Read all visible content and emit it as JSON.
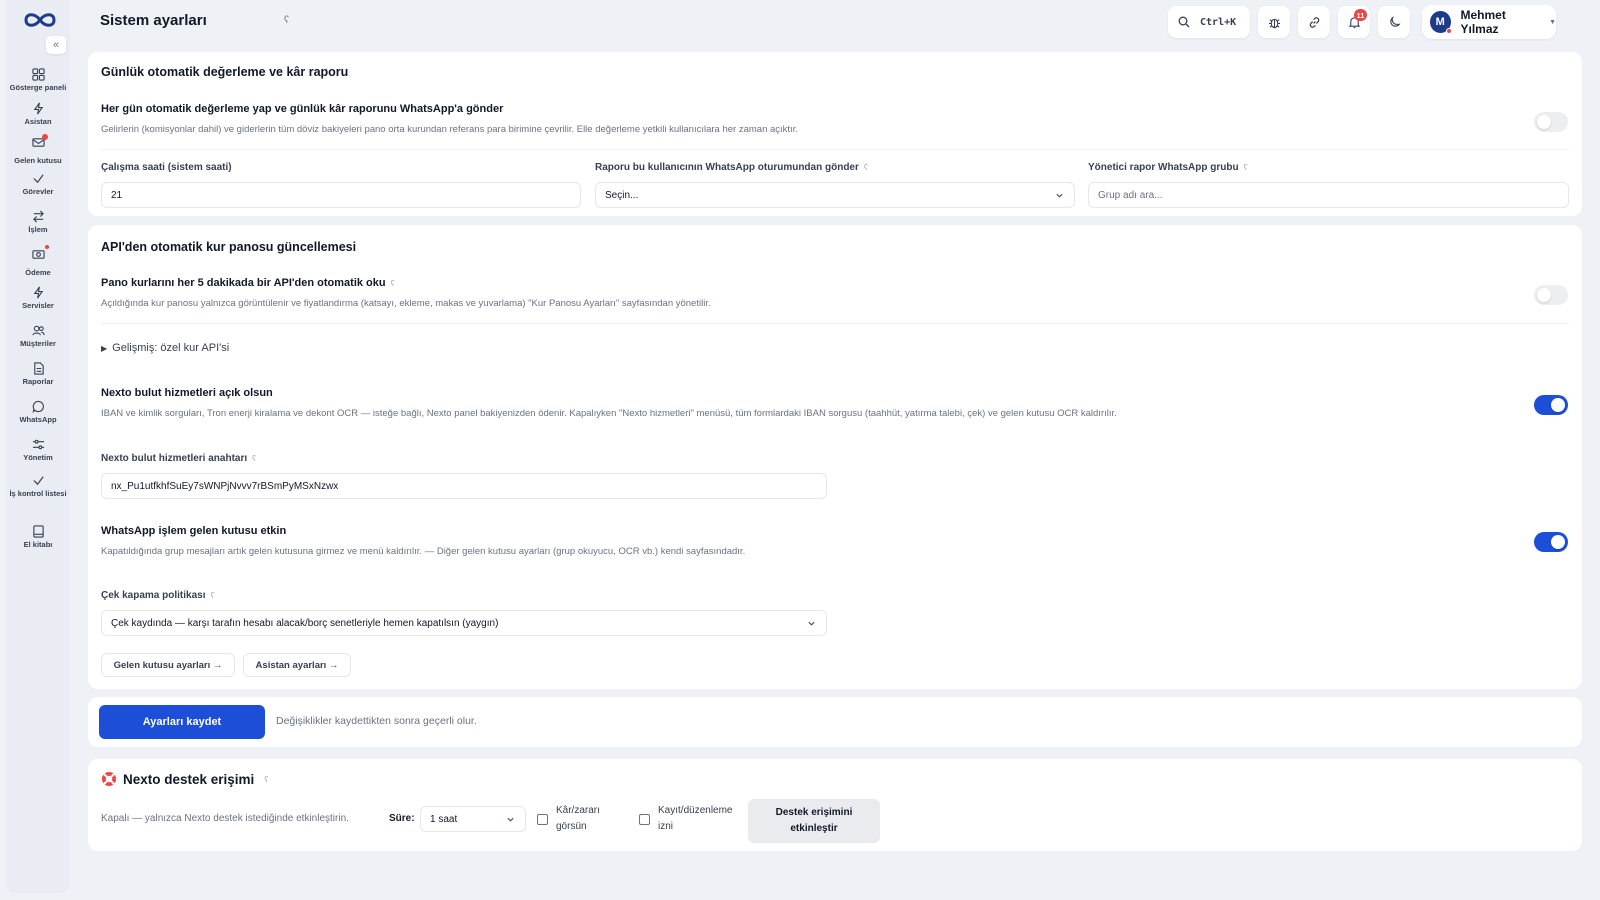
{
  "header": {
    "title": "Sistem ayarları",
    "title_hint": "ʕ",
    "search_shortcut": "Ctrl+K",
    "notification_count": "11",
    "user": {
      "initial": "M",
      "name": "Mehmet Yılmaz"
    }
  },
  "sidebar": {
    "items": [
      {
        "label": "Gösterge paneli",
        "icon": "dashboard-icon"
      },
      {
        "label": "Asistan",
        "icon": "bolt-icon"
      },
      {
        "label": "Gelen kutusu",
        "icon": "inbox-icon"
      },
      {
        "label": "Görevler",
        "icon": "check-icon"
      },
      {
        "label": "İşlem",
        "icon": "transfer-icon"
      },
      {
        "label": "Ödeme",
        "icon": "payment-icon"
      },
      {
        "label": "Servisler",
        "icon": "bolt-icon"
      },
      {
        "label": "Müşteriler",
        "icon": "users-icon"
      },
      {
        "label": "Raporlar",
        "icon": "report-icon"
      },
      {
        "label": "WhatsApp",
        "icon": "chat-icon"
      },
      {
        "label": "Yönetim",
        "icon": "sliders-icon"
      },
      {
        "label": "İş kontrol listesi",
        "icon": "check-icon"
      },
      {
        "label": "El kitabı",
        "icon": "book-icon"
      }
    ]
  },
  "daily_report": {
    "section_title": "Günlük otomatik değerleme ve kâr raporu",
    "setting_title": "Her gün otomatik değerleme yap ve günlük kâr raporunu WhatsApp'a gönder",
    "setting_desc": "Gelirlerin (komisyonlar dahil) ve giderlerin tüm döviz bakiyeleri pano orta kurundan referans para birimine çevrilir. Elle değerleme yetkili kullanıcılara her zaman açıktır.",
    "enabled": false,
    "hour_label": "Çalışma saati (sistem saati)",
    "hour_value": "21",
    "sender_label": "Raporu bu kullanıcının WhatsApp oturumundan gönder",
    "sender_value": "Seçin...",
    "group_label": "Yönetici rapor WhatsApp grubu",
    "group_placeholder": "Grup adı ara..."
  },
  "api_rates": {
    "section_title": "API'den otomatik kur panosu güncellemesi",
    "auto_title": "Pano kurlarını her 5 dakikada bir API'den otomatik oku",
    "auto_desc": "Açıldığında kur panosu yalnızca görüntülenir ve fiyatlandırma (katsayı, ekleme, makas ve yuvarlama) \"Kur Panosu Ayarları\" sayfasından yönetilir.",
    "auto_enabled": false,
    "advanced_label": "Gelişmiş: özel kur API'si",
    "nexto_title": "Nexto bulut hizmetleri açık olsun",
    "nexto_desc": "IBAN ve kimlik sorguları, Tron enerji kiralama ve dekont OCR — isteğe bağlı, Nexto panel bakiyenizden ödenir. Kapalıyken \"Nexto hizmetleri\" menüsü, tüm formlardaki IBAN sorgusu (taahhüt, yatırma talebi, çek) ve gelen kutusu OCR kaldırılır.",
    "nexto_enabled": true,
    "key_label": "Nexto bulut hizmetleri anahtarı",
    "key_value": "nx_Pu1utfkhfSuEy7sWNPjNvvv7rBSmPyMSxNzwx",
    "wa_title": "WhatsApp işlem gelen kutusu etkin",
    "wa_desc": "Kapatıldığında grup mesajları artık gelen kutusuna girmez ve menü kaldırılır. — Diğer gelen kutusu ayarları (grup okuyucu, OCR vb.) kendi sayfasındadır.",
    "wa_enabled": true,
    "check_label": "Çek kapama politikası",
    "check_value": "Çek kaydında — karşı tarafın hesabı alacak/borç senetleriyle hemen kapatılsın (yaygın)",
    "inbox_settings_btn": "Gelen kutusu ayarları →",
    "assistant_settings_btn": "Asistan ayarları →"
  },
  "save": {
    "button": "Ayarları kaydet",
    "note": "Değişiklikler kaydettikten sonra geçerli olur."
  },
  "support": {
    "title": "Nexto destek erişimi",
    "status": "Kapalı — yalnızca Nexto destek istediğinde etkinleştirin.",
    "duration_label": "Süre:",
    "duration_value": "1 saat",
    "profit_line1": "Kâr/zararı",
    "profit_line2": "görsün",
    "edit_line1": "Kayıt/düzenleme",
    "edit_line2": "izni",
    "enable_line1": "Destek erişimini",
    "enable_line2": "etkinleştir"
  },
  "colors": {
    "accent": "#1d4ed8",
    "alert": "#ef4444",
    "background": "#eef1f6"
  }
}
